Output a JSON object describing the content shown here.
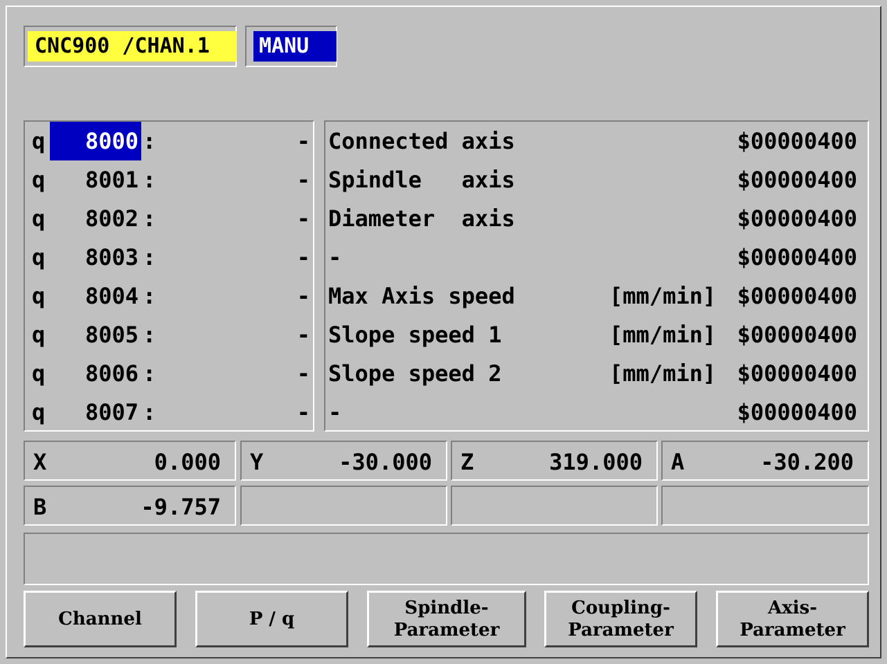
{
  "header": {
    "title": "CNC900 /CHAN.1",
    "mode": "MANU"
  },
  "colors": {
    "title_bg": "#ffff40",
    "mode_bg": "#0000c0",
    "selection_bg": "#0000c0",
    "panel_bg": "#c0c0c0"
  },
  "q_params": [
    {
      "prefix": "q",
      "number": "8000",
      "colon": ":",
      "value": "-",
      "selected": true
    },
    {
      "prefix": "q",
      "number": "8001",
      "colon": ":",
      "value": "-"
    },
    {
      "prefix": "q",
      "number": "8002",
      "colon": ":",
      "value": "-"
    },
    {
      "prefix": "q",
      "number": "8003",
      "colon": ":",
      "value": "-"
    },
    {
      "prefix": "q",
      "number": "8004",
      "colon": ":",
      "value": "-"
    },
    {
      "prefix": "q",
      "number": "8005",
      "colon": ":",
      "value": "-"
    },
    {
      "prefix": "q",
      "number": "8006",
      "colon": ":",
      "value": "-"
    },
    {
      "prefix": "q",
      "number": "8007",
      "colon": ":",
      "value": "-"
    }
  ],
  "param_list": [
    {
      "label": "Connected axis",
      "unit": "",
      "value": "$00000400"
    },
    {
      "label": "Spindle   axis",
      "unit": "",
      "value": "$00000400"
    },
    {
      "label": "Diameter  axis",
      "unit": "",
      "value": "$00000400"
    },
    {
      "label": "-",
      "unit": "",
      "value": "$00000400"
    },
    {
      "label": "Max Axis speed",
      "unit": "[mm/min]",
      "value": "$00000400"
    },
    {
      "label": "Slope speed 1",
      "unit": "[mm/min]",
      "value": "$00000400"
    },
    {
      "label": "Slope speed 2",
      "unit": "[mm/min]",
      "value": "$00000400"
    },
    {
      "label": "-",
      "unit": "",
      "value": "$00000400"
    }
  ],
  "axes": [
    {
      "name": "X",
      "value": "0.000"
    },
    {
      "name": "Y",
      "value": "-30.000"
    },
    {
      "name": "Z",
      "value": "319.000"
    },
    {
      "name": "A",
      "value": "-30.200"
    },
    {
      "name": "B",
      "value": "-9.757"
    },
    {
      "name": "",
      "value": ""
    },
    {
      "name": "",
      "value": ""
    },
    {
      "name": "",
      "value": ""
    }
  ],
  "message_line": "",
  "softkeys": [
    {
      "line1": "Channel",
      "line2": ""
    },
    {
      "line1": "P / q",
      "line2": ""
    },
    {
      "line1": "Spindle-",
      "line2": "Parameter"
    },
    {
      "line1": "Coupling-",
      "line2": "Parameter"
    },
    {
      "line1": "Axis-",
      "line2": "Parameter"
    }
  ]
}
